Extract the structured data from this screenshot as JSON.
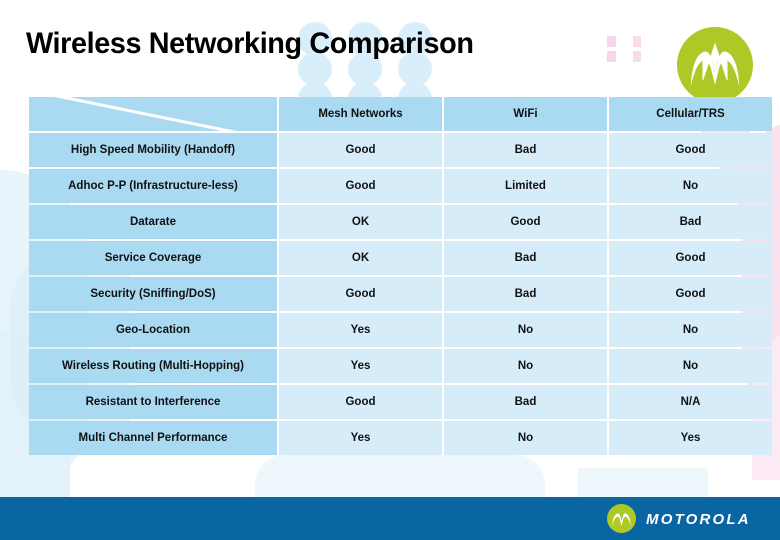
{
  "slide": {
    "title": "Wireless Networking Comparison",
    "brand_name": "MOTOROLA",
    "colors": {
      "header_cell": "#A9DAF2",
      "data_cell": "#D6EDF9",
      "footer_bar": "#0A66A3",
      "logo_green": "#AEC925",
      "value_good": "#111111",
      "value_bad": "#C8102E",
      "value_ok": "#1B3D8F"
    },
    "icons": {
      "top_logo": "motorola-batwing-icon",
      "footer_logo": "motorola-batwing-icon",
      "corner_slash": "diagonal-slash-icon"
    }
  },
  "table": {
    "corner_label": "",
    "columns": [
      "Mesh Networks",
      "WiFi",
      "Cellular/TRS"
    ],
    "rows": [
      {
        "label": "High Speed Mobility (Handoff)",
        "cells": [
          {
            "text": "Good",
            "tone": "good"
          },
          {
            "text": "Bad",
            "tone": "bad"
          },
          {
            "text": "Good",
            "tone": "good"
          }
        ]
      },
      {
        "label": "Adhoc P-P (Infrastructure-less)",
        "cells": [
          {
            "text": "Good",
            "tone": "good"
          },
          {
            "text": "Limited",
            "tone": "bad"
          },
          {
            "text": "No",
            "tone": "bad"
          }
        ]
      },
      {
        "label": "Datarate",
        "cells": [
          {
            "text": "OK",
            "tone": "ok"
          },
          {
            "text": "Good",
            "tone": "good"
          },
          {
            "text": "Bad",
            "tone": "bad"
          }
        ]
      },
      {
        "label": "Service Coverage",
        "cells": [
          {
            "text": "OK",
            "tone": "ok"
          },
          {
            "text": "Bad",
            "tone": "bad"
          },
          {
            "text": "Good",
            "tone": "good"
          }
        ]
      },
      {
        "label": "Security (Sniffing/DoS)",
        "cells": [
          {
            "text": "Good",
            "tone": "good"
          },
          {
            "text": "Bad",
            "tone": "bad"
          },
          {
            "text": "Good",
            "tone": "good"
          }
        ]
      },
      {
        "label": "Geo-Location",
        "cells": [
          {
            "text": "Yes",
            "tone": "good"
          },
          {
            "text": "No",
            "tone": "bad"
          },
          {
            "text": "No",
            "tone": "bad"
          }
        ]
      },
      {
        "label": "Wireless Routing (Multi-Hopping)",
        "cells": [
          {
            "text": "Yes",
            "tone": "good"
          },
          {
            "text": "No",
            "tone": "bad"
          },
          {
            "text": "No",
            "tone": "bad"
          }
        ]
      },
      {
        "label": "Resistant to Interference",
        "cells": [
          {
            "text": "Good",
            "tone": "good"
          },
          {
            "text": "Bad",
            "tone": "bad"
          },
          {
            "text": "N/A",
            "tone": "neutral"
          }
        ]
      },
      {
        "label": "Multi Channel Performance",
        "cells": [
          {
            "text": "Yes",
            "tone": "good"
          },
          {
            "text": "No",
            "tone": "bad"
          },
          {
            "text": "Yes",
            "tone": "good"
          }
        ]
      }
    ]
  }
}
